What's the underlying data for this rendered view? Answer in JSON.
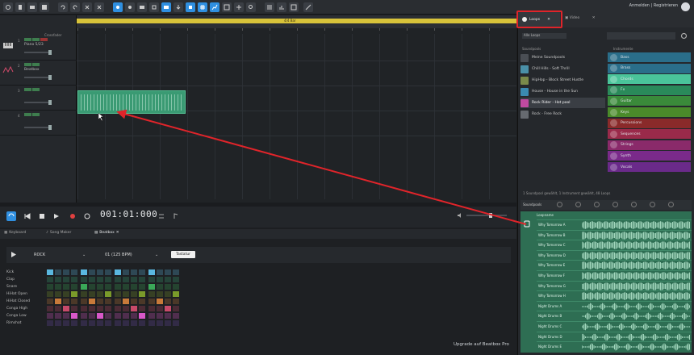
{
  "colors": {
    "accent": "#2f8fe0",
    "ruler": "#d8c33a",
    "clip": "#3a9a73",
    "loops": "#2e6e53",
    "highlight": "#e0242a"
  },
  "header": {
    "login": "Anmelden | Registrieren"
  },
  "arranger": {
    "ruler_marker": "4/4 Bar",
    "mixer_label": "Crossfader",
    "tracks": [
      {
        "num": "1",
        "name": "Piano 5/23",
        "icon": "piano-icon"
      },
      {
        "num": "2",
        "name": "Beatbox",
        "icon": "drum-icon"
      },
      {
        "num": "3",
        "name": "",
        "icon": "none"
      },
      {
        "num": "4",
        "name": "",
        "icon": "none"
      }
    ]
  },
  "transport": {
    "time": "001:01:000"
  },
  "tabs": [
    {
      "label": "Keyboard",
      "icon": "keyboard-icon"
    },
    {
      "label": "Song Maker",
      "icon": "note-icon"
    },
    {
      "label": "Beatbox",
      "icon": "grid-icon"
    }
  ],
  "beatbox": {
    "kit": "ROCK",
    "pattern": "01 (125 BPM)",
    "key_button": "Tastatur",
    "rows": [
      "Kick",
      "Clap",
      "Snare",
      "HiHat Open",
      "HiHat Closed",
      "Conga High",
      "Conga Low",
      "Rimshot"
    ],
    "upgrade": "Upgrade auf Beatbox Pro"
  },
  "browser": {
    "tabs": [
      {
        "label": "Loops"
      },
      {
        "label": "Video"
      }
    ],
    "filter": "Alle Loops",
    "soundpools_header": "Soundpools",
    "instruments_header": "Instrumente",
    "soundpools": [
      {
        "name": "Meine Soundpools",
        "color": "#4a4e54"
      },
      {
        "name": "Chill Hills - Soft Thrill",
        "color": "#4a90a8"
      },
      {
        "name": "HipHop - Block Street Hustle",
        "color": "#7a8a4a"
      },
      {
        "name": "House - House in the Sun",
        "color": "#3a8ab0"
      },
      {
        "name": "Rock Rider - Hot pool",
        "color": "#c04aa0"
      },
      {
        "name": "Rock - Free Rock",
        "color": "#666a70"
      }
    ],
    "instruments": [
      {
        "name": "Bass",
        "color": "#2a6e8a",
        "icon": "bass-icon"
      },
      {
        "name": "Brass",
        "color": "#2a6e8a",
        "icon": "brass-icon"
      },
      {
        "name": "Chords",
        "color": "#2a9a78",
        "icon": "chords-icon"
      },
      {
        "name": "Fx",
        "color": "#2a8a5a",
        "icon": "fx-icon"
      },
      {
        "name": "Guitar",
        "color": "#3a8a3a",
        "icon": "guitar-icon"
      },
      {
        "name": "Keys",
        "color": "#4a8a2a",
        "icon": "keys-icon"
      },
      {
        "name": "Percussions",
        "color": "#8a2a2a",
        "icon": "percussion-icon"
      },
      {
        "name": "Sequences",
        "color": "#9a2a4a",
        "icon": "sequence-icon"
      },
      {
        "name": "Strings",
        "color": "#8a2a6a",
        "icon": "strings-icon"
      },
      {
        "name": "Synth",
        "color": "#7a2a8a",
        "icon": "synth-icon"
      },
      {
        "name": "Vocals",
        "color": "#6a2a8a",
        "icon": "vocals-icon"
      }
    ],
    "status": "1 Soundpool gewählt, 1 Instrument gewählt, 48 Loops",
    "loops_bar_label": "Soundpools",
    "loopname_header": "Loopname",
    "loops": [
      "Why Tomorrow A",
      "Why Tomorrow B",
      "Why Tomorrow C",
      "Why Tomorrow D",
      "Why Tomorrow E",
      "Why Tomorrow F",
      "Why Tomorrow G",
      "Why Tomorrow H",
      "Night Drums A",
      "Night Drums B",
      "Night Drums C",
      "Night Drums D",
      "Night Drums E"
    ]
  }
}
